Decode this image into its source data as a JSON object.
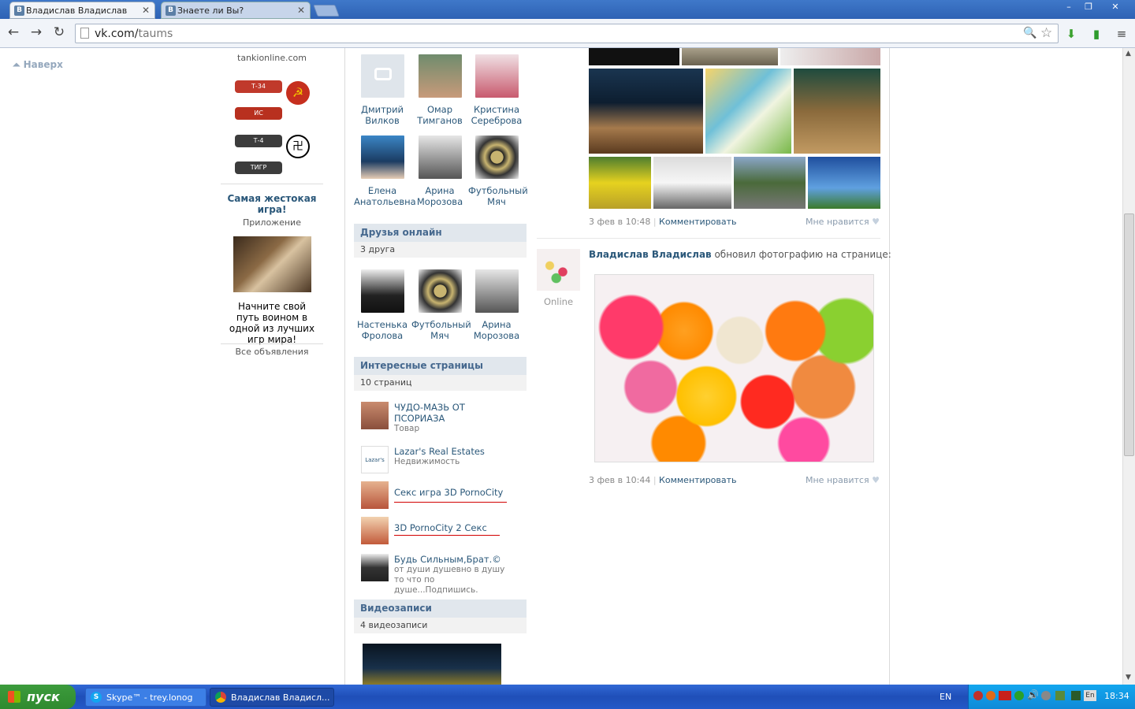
{
  "browser": {
    "tabs": [
      {
        "label": "Владислав Владислав",
        "favicon": "B"
      },
      {
        "label": "Знаете ли Вы?",
        "favicon": "B"
      }
    ],
    "url_host": "vk.com/",
    "url_path": "taums",
    "window_buttons": [
      "–",
      "❐",
      "✕"
    ]
  },
  "left": {
    "to_top": "Наверх"
  },
  "ads": {
    "ad1_link": "tankionline.com",
    "tanks": [
      "Т-34",
      "ИС",
      "Т-4",
      "ТИГР"
    ],
    "ad2_title": "Самая жестокая игра!",
    "ad2_type": "Приложение",
    "ad2_text": "Начните свой путь воином в одной из лучших игр мира!",
    "all_ads": "Все объявления"
  },
  "friends": [
    {
      "first": "Дмитрий",
      "last": "Вилков"
    },
    {
      "first": "Омар",
      "last": "Тимганов"
    },
    {
      "first": "Кристина",
      "last": "Сереброва"
    },
    {
      "first": "Елена",
      "last": "Анатольевна"
    },
    {
      "first": "Арина",
      "last": "Морозова"
    },
    {
      "first": "Футбольный",
      "last": "Мяч"
    }
  ],
  "online": {
    "title": "Друзья онлайн",
    "count": "3 друга",
    "people": [
      {
        "first": "Настенька",
        "last": "Фролова"
      },
      {
        "first": "Футбольный",
        "last": "Мяч"
      },
      {
        "first": "Арина",
        "last": "Морозова"
      }
    ]
  },
  "pages": {
    "title": "Интересные страницы",
    "count": "10 страниц",
    "items": [
      {
        "title": "ЧУДО-МАЗЬ ОТ ПСОРИАЗА",
        "sub": "Товар"
      },
      {
        "title": "Lazar's Real Estates",
        "sub": "Недвижимость"
      },
      {
        "title": "Секс игра 3D PornoCity",
        "sub": ""
      },
      {
        "title": "3D PornoCity 2 Секс",
        "sub": ""
      },
      {
        "title": "Будь Сильным,Брат.©",
        "sub": "от души душевно в душу то что по душе...Подпишись."
      }
    ]
  },
  "videos": {
    "title": "Видеозаписи",
    "count": "4 видеозаписи"
  },
  "wall": {
    "post1": {
      "date": "3 фев в 10:48",
      "comment": "Комментировать",
      "like": "Мне нравится"
    },
    "post2": {
      "author": "Владислав Владислав",
      "action": "обновил фотографию на странице:",
      "status": "Online",
      "date": "3 фев в 10:44",
      "comment": "Комментировать",
      "like": "Мне нравится"
    }
  },
  "taskbar": {
    "start": "пуск",
    "tasks": [
      "Skype™ - trey.lonog",
      "Владислав Владисл..."
    ],
    "lang": "EN",
    "tray_lang": "En",
    "time": "18:34"
  },
  "colors": {
    "link": "#2b587a",
    "head_bg": "#e1e7ed",
    "head_text": "#45688e",
    "accent_red": "#d20000"
  }
}
